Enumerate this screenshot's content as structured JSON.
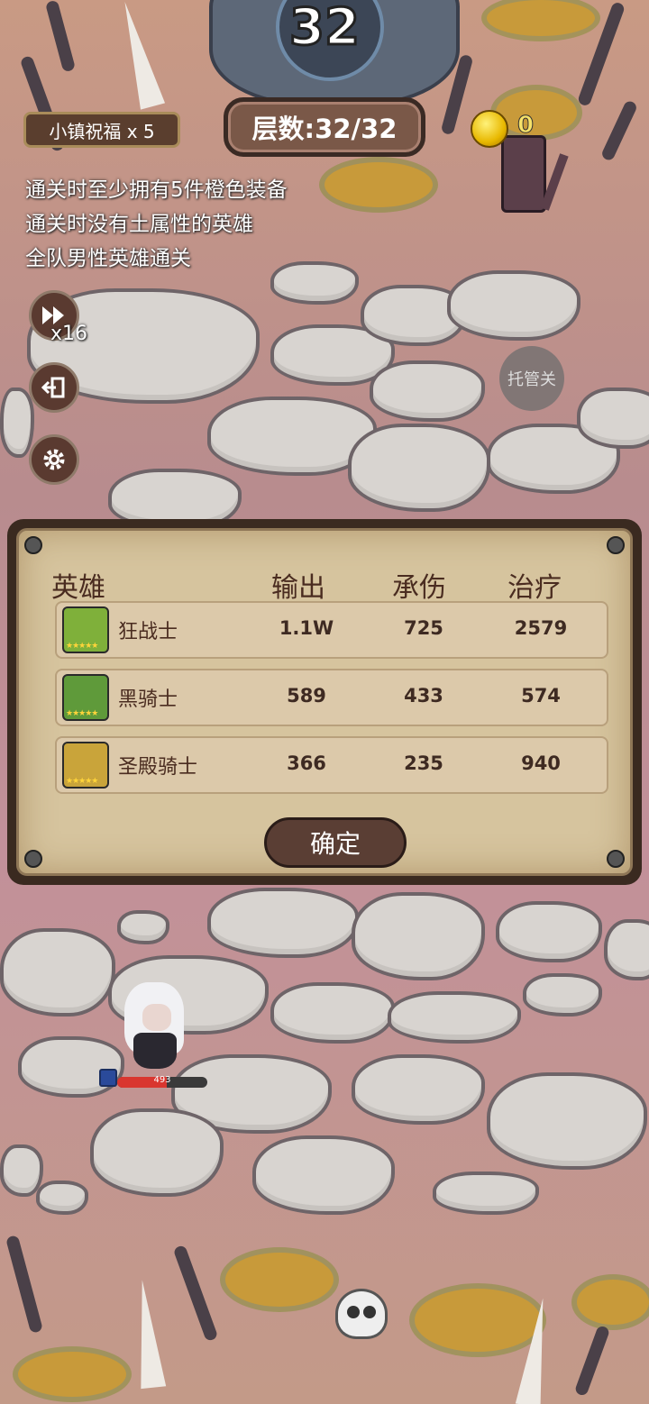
{
  "floor_number": "32",
  "blessing_label": "小镇祝福 x 5",
  "layer_label": "层数:32/32",
  "coins": "0",
  "conditions": [
    "通关时至少拥有5件橙色装备",
    "通关时没有土属性的英雄",
    "全队男性英雄通关"
  ],
  "controls": {
    "speed_label": "x16",
    "auto_label": "托管关"
  },
  "result_panel": {
    "headers": [
      "英雄",
      "输出",
      "承伤",
      "治疗"
    ],
    "rows": [
      {
        "name": "狂战士",
        "output": "1.1W",
        "damage_taken": "725",
        "healing": "2579",
        "stars": "★★★★★",
        "avatar_color": "#7fb03a"
      },
      {
        "name": "黑骑士",
        "output": "589",
        "damage_taken": "433",
        "healing": "574",
        "stars": "★★★★★",
        "avatar_color": "#5f9a3a"
      },
      {
        "name": "圣殿骑士",
        "output": "366",
        "damage_taken": "235",
        "healing": "940",
        "stars": "★★★★★",
        "avatar_color": "#c9a43a"
      }
    ],
    "confirm_label": "确定"
  },
  "unit": {
    "hp_text": "493",
    "hp_fraction": 0.55
  },
  "icons": {
    "speed": "fast-forward-icon",
    "exit": "exit-icon",
    "settings": "gear-icon",
    "coin": "coin-icon",
    "skull": "skull-icon"
  }
}
